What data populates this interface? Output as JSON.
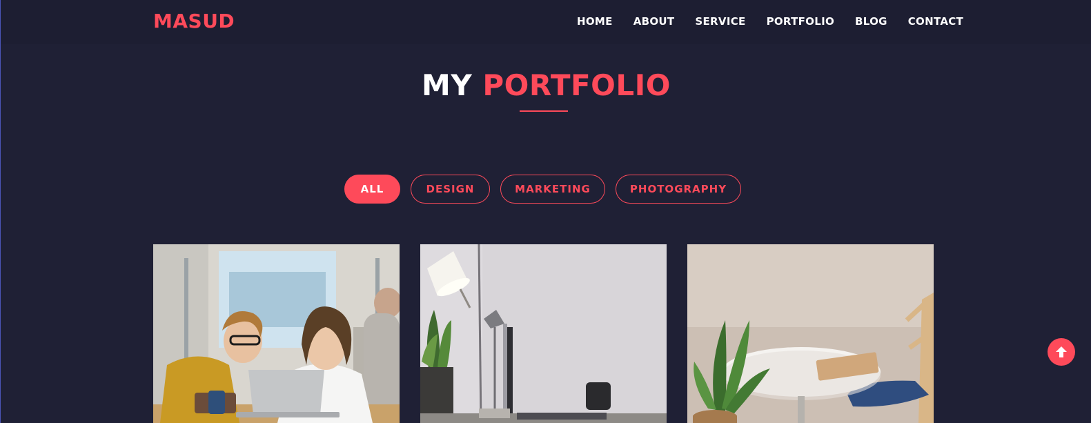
{
  "brand": {
    "logo": "MASUD",
    "accent_color": "#fe4a5a",
    "background_color": "#1f2035"
  },
  "nav": {
    "items": [
      {
        "label": "HOME"
      },
      {
        "label": "ABOUT"
      },
      {
        "label": "SERVICE"
      },
      {
        "label": "PORTFOLIO"
      },
      {
        "label": "BLOG"
      },
      {
        "label": "CONTACT"
      }
    ]
  },
  "section": {
    "title_part1": "MY",
    "title_part2": "PORTFOLIO"
  },
  "filters": {
    "active": "ALL",
    "items": [
      {
        "label": "ALL"
      },
      {
        "label": "DESIGN"
      },
      {
        "label": "MARKETING"
      },
      {
        "label": "PHOTOGRAPHY"
      }
    ]
  },
  "portfolio": {
    "items": [
      {
        "image": "two-students-with-laptop-photo"
      },
      {
        "image": "desk-lamp-and-computer-photo"
      },
      {
        "image": "round-table-with-plant-and-chair-photo"
      }
    ]
  },
  "back_to_top": {
    "icon": "arrow-up-icon"
  }
}
